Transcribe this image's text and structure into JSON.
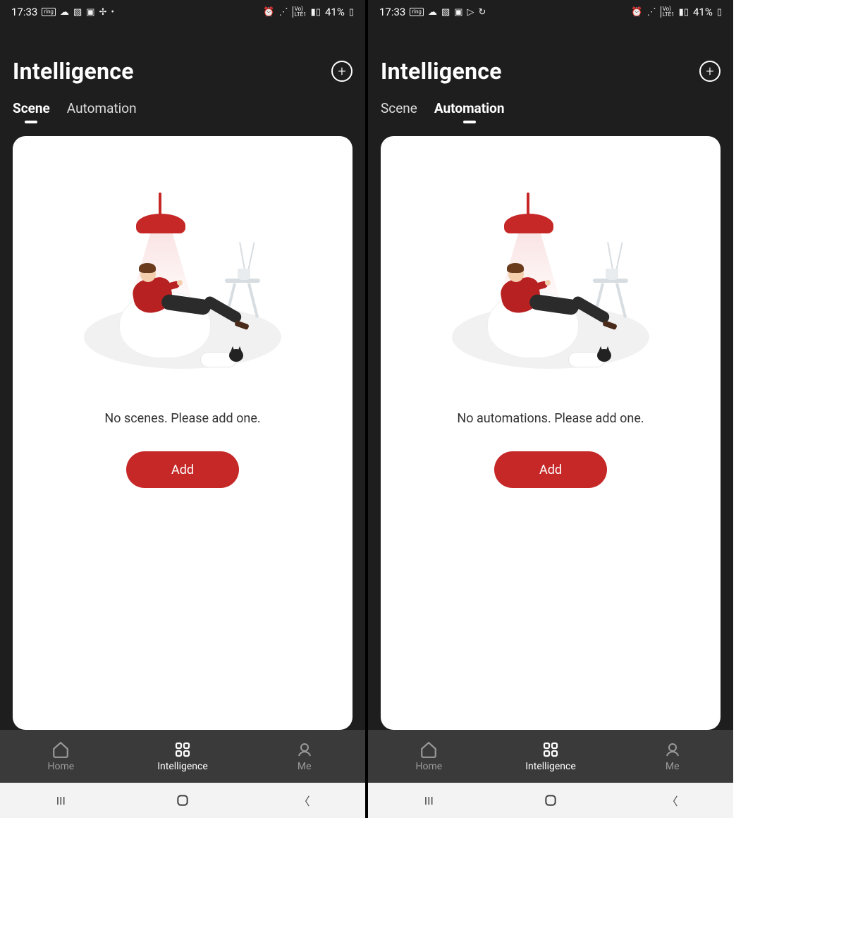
{
  "status": {
    "time": "17:33",
    "battery": "41%",
    "icons_left": [
      "ring",
      "cloud",
      "image",
      "camera-off",
      "pinwheel",
      "dot"
    ],
    "icons_left_b": [
      "ring",
      "cloud",
      "image",
      "camera-off",
      "play",
      "sync"
    ],
    "icons_right": [
      "alarm",
      "wifi",
      "volte",
      "signal"
    ]
  },
  "header": {
    "title": "Intelligence"
  },
  "tabs": {
    "scene": "Scene",
    "automation": "Automation"
  },
  "screens": [
    {
      "active_tab": "scene",
      "empty_msg": "No scenes. Please add one.",
      "add_label": "Add"
    },
    {
      "active_tab": "automation",
      "empty_msg": "No automations. Please add one.",
      "add_label": "Add"
    }
  ],
  "nav": {
    "items": [
      {
        "label": "Home"
      },
      {
        "label": "Intelligence"
      },
      {
        "label": "Me"
      }
    ],
    "active_index": 1
  }
}
